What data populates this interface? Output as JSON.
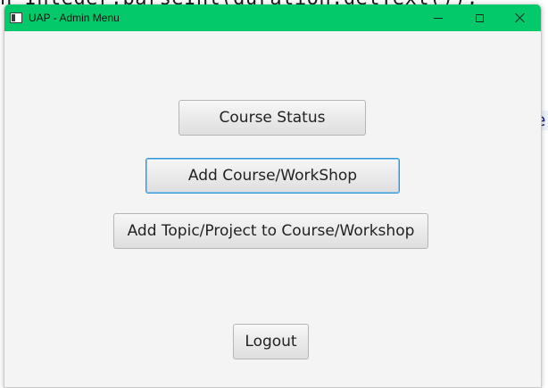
{
  "window": {
    "title": "UAP - Admin Menu",
    "titlebar_color": "#04c96a"
  },
  "background": {
    "code_line": "n  Integer.parseInt(duration.getText());"
  },
  "menu": {
    "course_status_label": "Course Status",
    "add_course_label": "Add Course/WorkShop",
    "add_topic_label": "Add Topic/Project to Course/Workshop",
    "logout_label": "Logout"
  },
  "icons": {
    "app": "app-window-icon",
    "minimize": "minimize-icon",
    "maximize": "maximize-icon",
    "close": "close-icon"
  }
}
